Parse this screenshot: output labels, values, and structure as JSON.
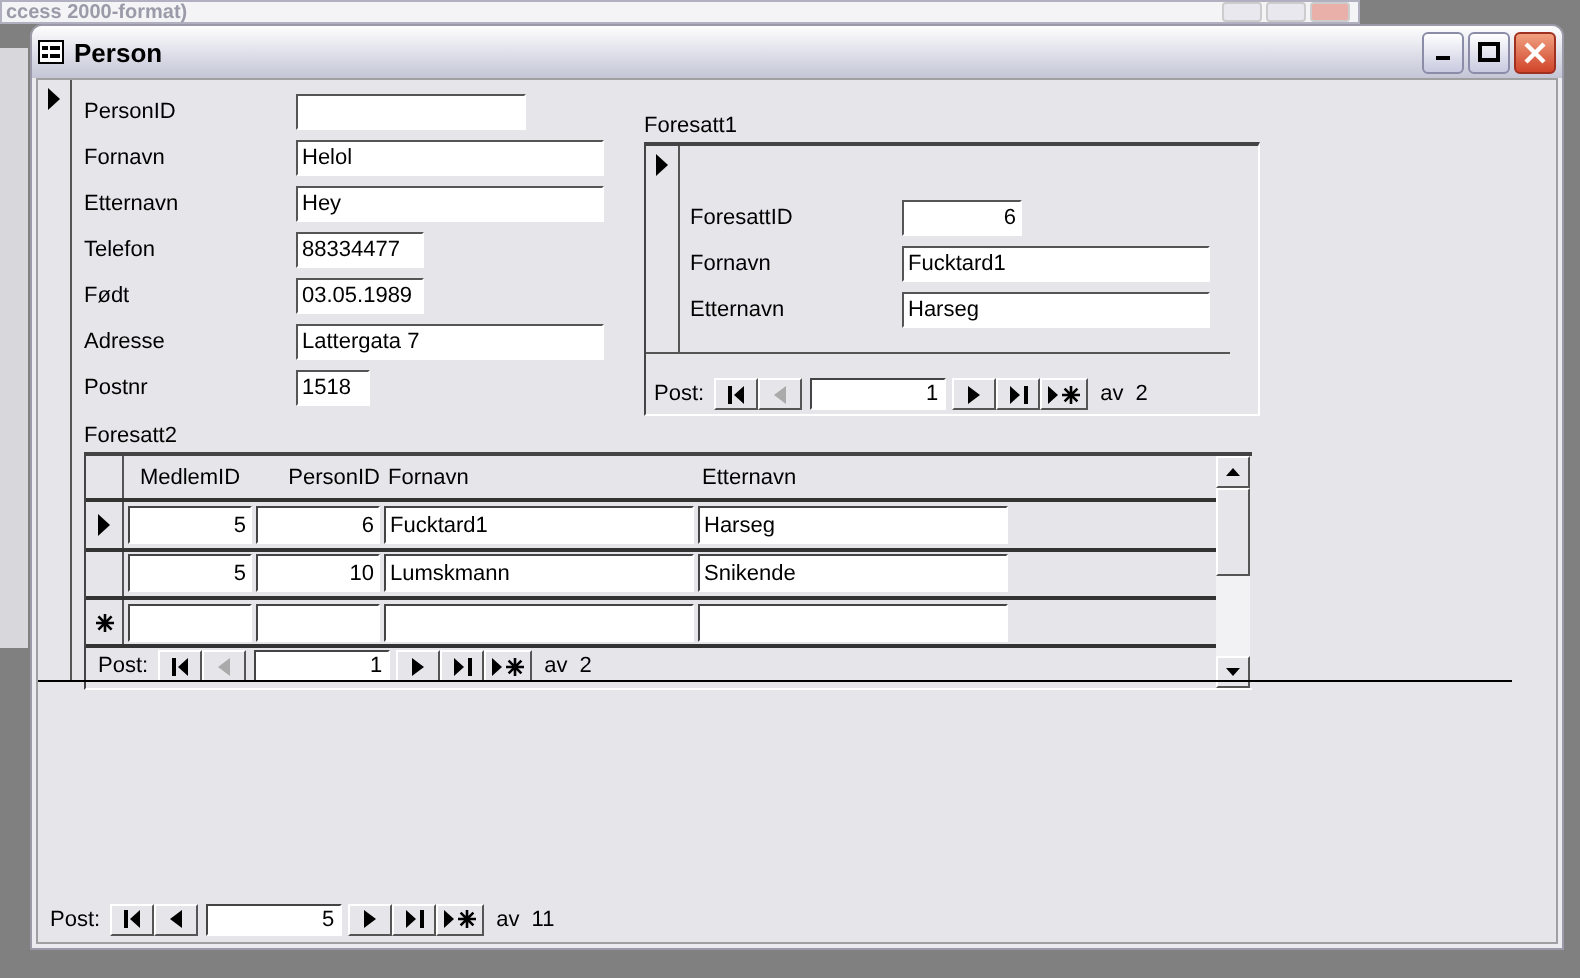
{
  "background_window": {
    "title": "ccess 2000-format)"
  },
  "window": {
    "title": "Person"
  },
  "record_selector": {
    "selected": true
  },
  "fields": [
    {
      "label": "PersonID",
      "kind": "medium"
    },
    {
      "label": "Fornavn",
      "value": "Helol",
      "kind": "wide"
    },
    {
      "label": "Etternavn",
      "value": "Hey",
      "kind": "wide"
    },
    {
      "label": "Telefon",
      "value": "88334477",
      "kind": "short"
    },
    {
      "label": "Født",
      "value": "03.05.1989",
      "kind": "short"
    },
    {
      "label": "Adresse",
      "value": "Lattergata 7",
      "kind": "wide"
    },
    {
      "label": "Postnr",
      "value": "1518",
      "kind": "tiny"
    }
  ],
  "subform1": {
    "label": "Foresatt1",
    "record_selector": {
      "selected": true
    },
    "fields": [
      {
        "label": "ForesattID",
        "value": "6",
        "kind": "number"
      },
      {
        "label": "Fornavn",
        "value": "Fucktard1",
        "kind": "wide"
      },
      {
        "label": "Etternavn",
        "value": "Harseg",
        "kind": "wide"
      }
    ],
    "nav": {
      "label": "Post:",
      "record": "1",
      "count": "av  2",
      "buttons": [
        {
          "kind": "first",
          "disabled": false
        },
        {
          "kind": "prev",
          "disabled": true
        },
        {
          "kind": "next",
          "disabled": false
        },
        {
          "kind": "last",
          "disabled": false
        },
        {
          "kind": "new",
          "disabled": false
        }
      ]
    }
  },
  "subform2": {
    "label": "Foresatt2",
    "columns": [
      "MedlemID",
      "PersonID",
      "Fornavn",
      "Etternavn"
    ],
    "rows": [
      {
        "selected": true,
        "cells": [
          "5",
          "6",
          "Fucktard1",
          "Harseg"
        ]
      },
      {
        "selected": false,
        "cells": [
          "5",
          "10",
          "Lumskmann",
          "Snikende"
        ]
      }
    ],
    "new_row": true,
    "nav": {
      "label": "Post:",
      "record": "1",
      "count": "av  2",
      "buttons": [
        {
          "kind": "first",
          "disabled": false
        },
        {
          "kind": "prev",
          "disabled": true
        },
        {
          "kind": "next",
          "disabled": false
        },
        {
          "kind": "last",
          "disabled": false
        },
        {
          "kind": "new",
          "disabled": false
        }
      ]
    }
  },
  "nav": {
    "label": "Post:",
    "record": "5",
    "count": "av  11",
    "buttons": [
      {
        "kind": "first",
        "disabled": false
      },
      {
        "kind": "prev",
        "disabled": false
      },
      {
        "kind": "next",
        "disabled": false
      },
      {
        "kind": "last",
        "disabled": false
      },
      {
        "kind": "new",
        "disabled": false
      }
    ]
  }
}
